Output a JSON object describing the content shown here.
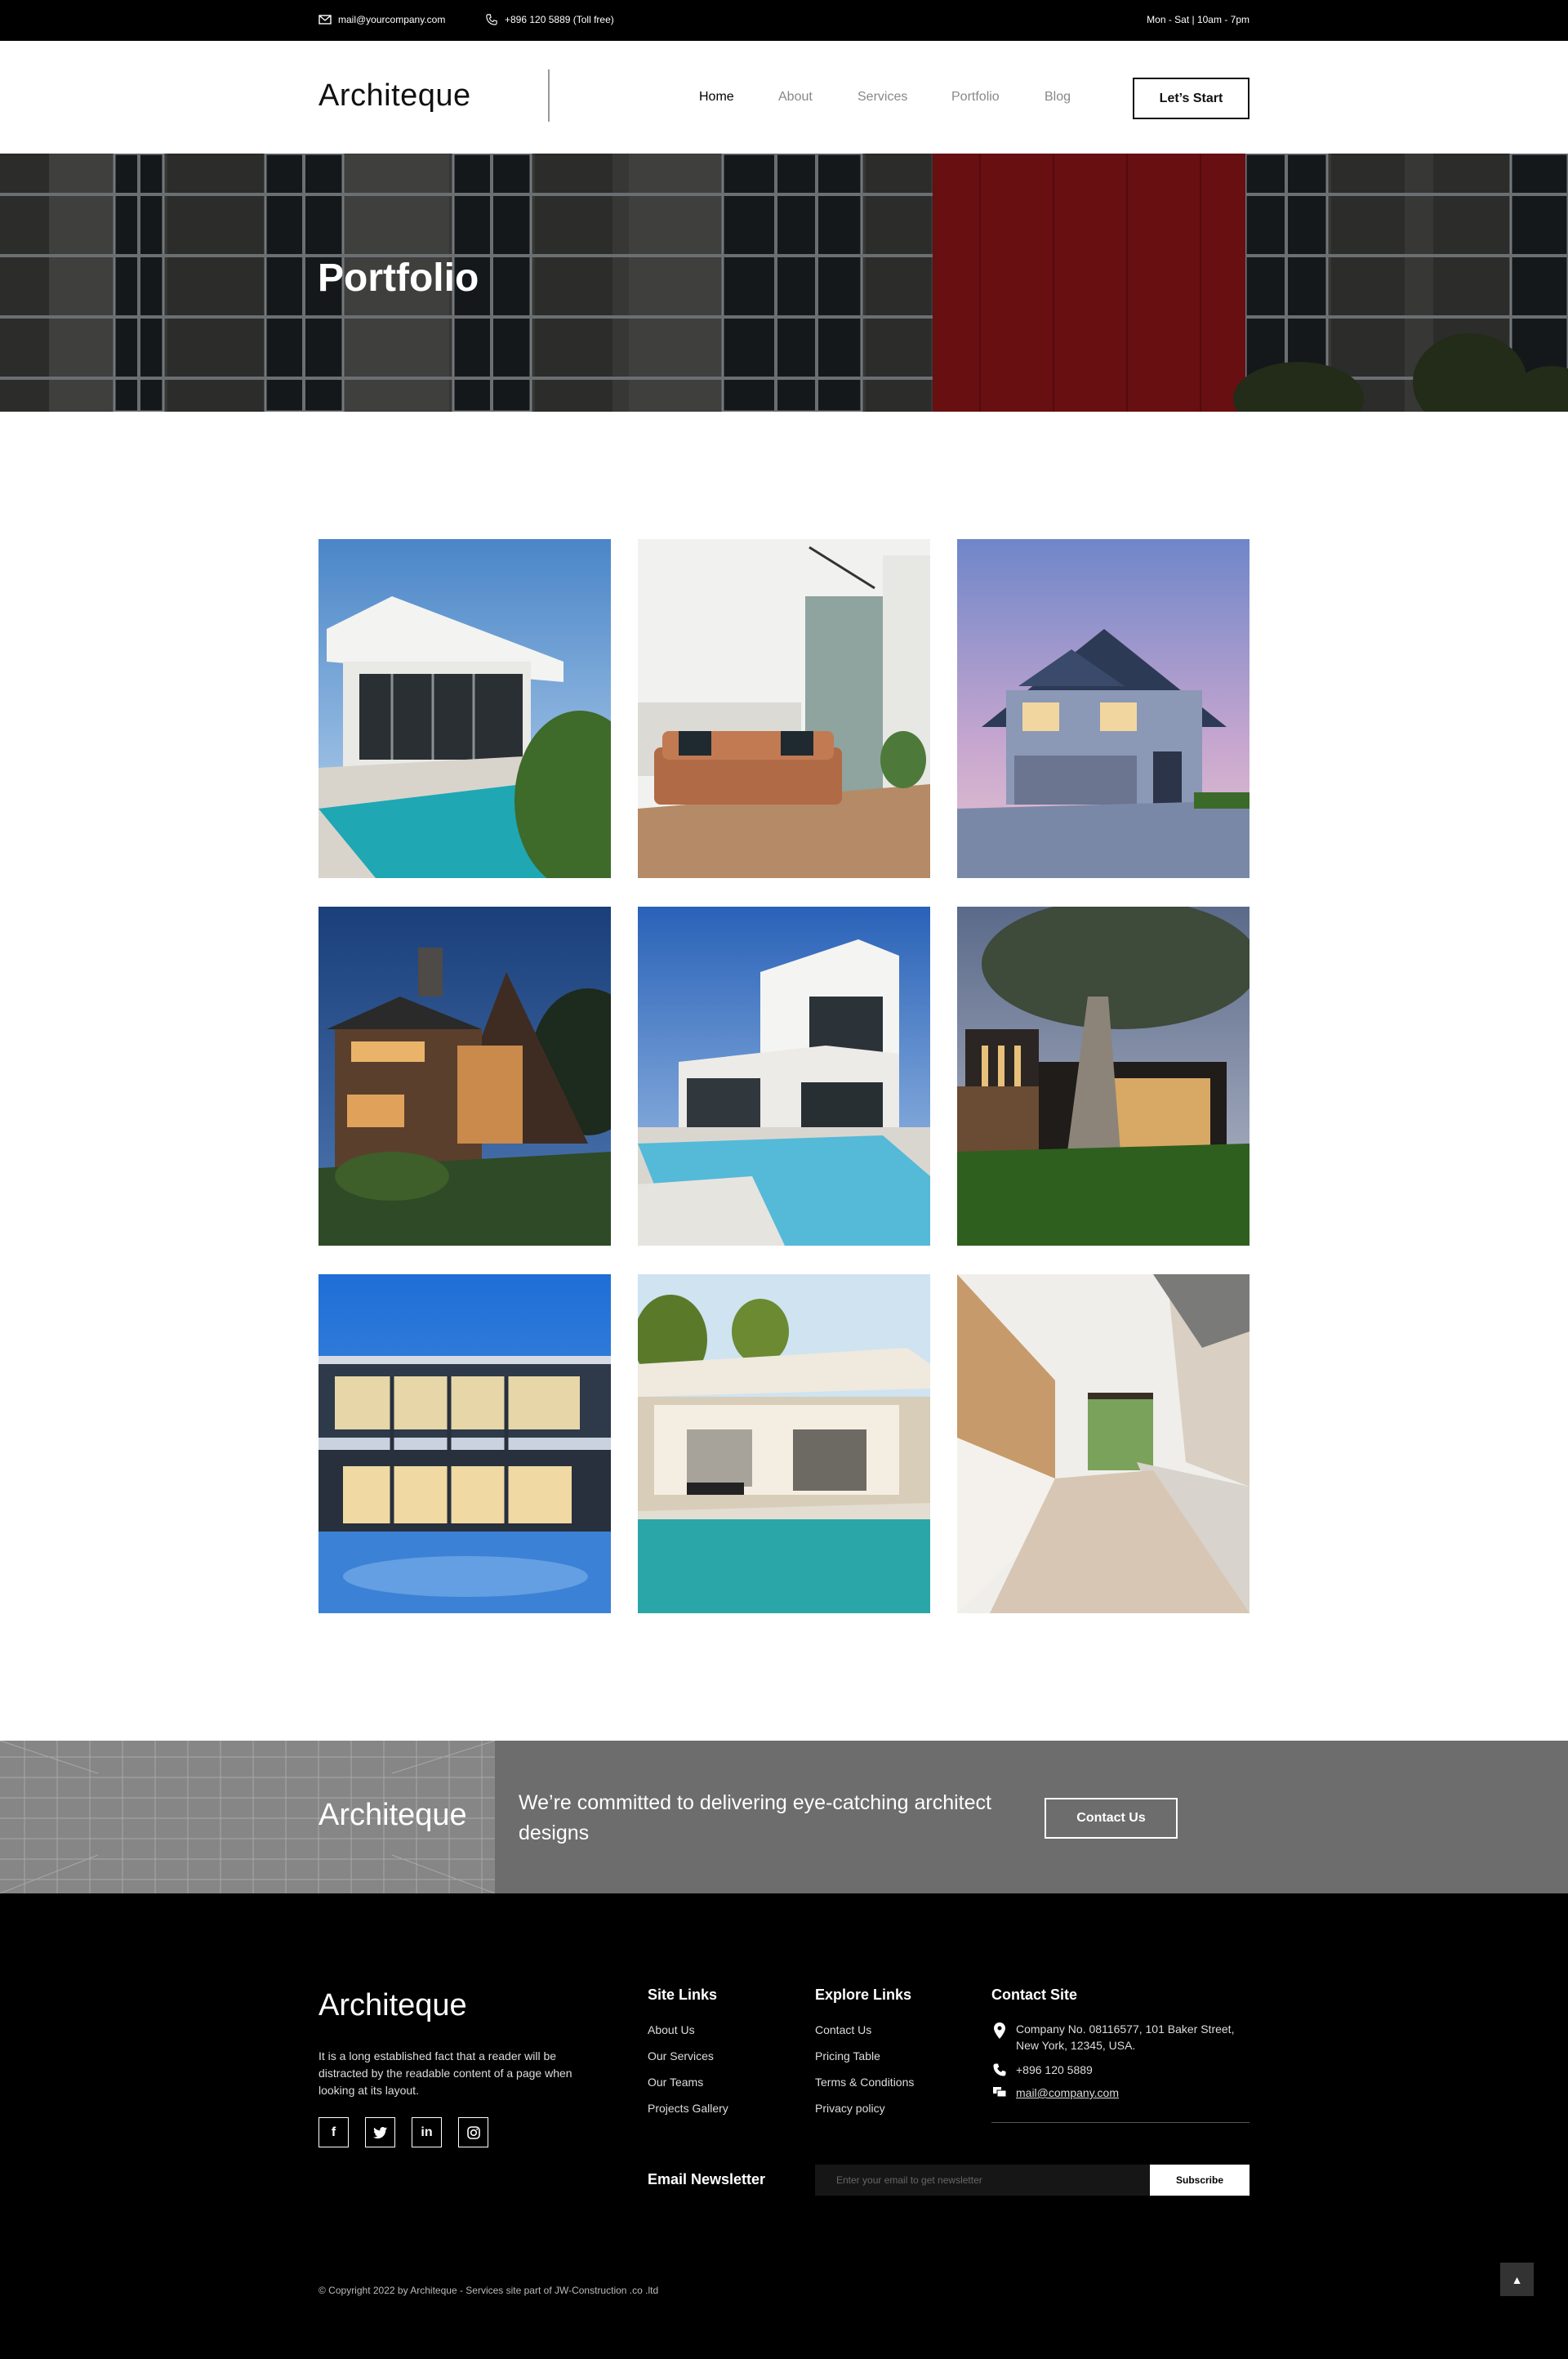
{
  "topbar": {
    "email": "mail@yourcompany.com",
    "phone": "+896 120 5889 (Toll free)",
    "hours": "Mon - Sat | 10am - 7pm"
  },
  "header": {
    "logo": "Architeque",
    "nav": [
      "Home",
      "About",
      "Services",
      "Portfolio",
      "Blog"
    ],
    "active_nav": "Home",
    "cta_label": "Let’s Start"
  },
  "hero": {
    "title": "Portfolio"
  },
  "gallery": {
    "items": [
      "modern-white-villa-pool",
      "living-room-leather-sofa",
      "suburban-house-dusk",
      "timber-house-night",
      "white-cube-villa-pool",
      "dark-house-with-tree",
      "glass-house-blue-hour",
      "patio-pool-house",
      "wood-kitchen-interior"
    ]
  },
  "band": {
    "logo": "Architeque",
    "tagline": "We’re committed to delivering eye-catching architect designs",
    "button": "Contact Us"
  },
  "footer": {
    "logo": "Architeque",
    "about": "It is a long established fact that a reader will be distracted by the readable content of a page when looking at its layout.",
    "socials": [
      "facebook-icon",
      "twitter-icon",
      "linkedin-icon",
      "instagram-icon"
    ],
    "site_links": {
      "heading": "Site Links",
      "items": [
        "About Us",
        "Our Services",
        "Our Teams",
        "Projects Gallery"
      ]
    },
    "explore_links": {
      "heading": "Explore Links",
      "items": [
        "Contact Us",
        "Pricing Table",
        "Terms & Conditions",
        "Privacy policy"
      ]
    },
    "contact": {
      "heading": "Contact Site",
      "address": "Company No. 08116577, 101 Baker Street, New York, 12345, USA.",
      "phone": "+896 120 5889",
      "email": "mail@company.com"
    },
    "newsletter": {
      "label": "Email Newsletter",
      "placeholder": "Enter your email to get newsletter",
      "button": "Subscribe"
    },
    "copyright": "© Copyright 2022 by Architeque - Services site part of JW-Construction .co .ltd"
  },
  "colors": {
    "topbar_bg": "#000000",
    "band_bg": "#6d6d6d",
    "footer_bg": "#000000",
    "hero_red_panel": "#8b1418"
  }
}
